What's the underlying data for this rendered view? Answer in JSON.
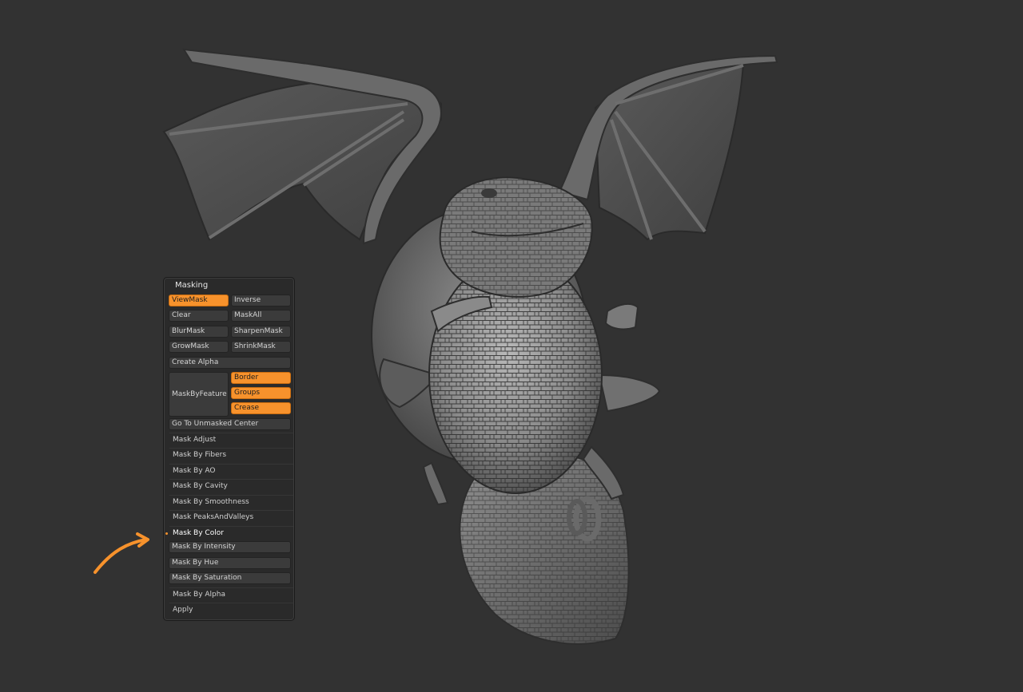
{
  "masking_panel": {
    "title": "Masking",
    "view_mask": "ViewMask",
    "inverse": "Inverse",
    "clear": "Clear",
    "mask_all": "MaskAll",
    "blur_mask": "BlurMask",
    "sharpen_mask": "SharpenMask",
    "grow_mask": "GrowMask",
    "shrink_mask": "ShrinkMask",
    "create_alpha": "Create Alpha",
    "mask_by_feature": "MaskByFeature",
    "border": "Border",
    "groups": "Groups",
    "crease": "Crease",
    "go_to_unmasked_center": "Go To Unmasked Center",
    "sub_items": [
      "Mask Adjust",
      "Mask By Fibers",
      "Mask By AO",
      "Mask By Cavity",
      "Mask By Smoothness",
      "Mask PeaksAndValleys",
      "Mask By Color",
      "Mask By Intensity",
      "Mask By Hue",
      "Mask By Saturation",
      "Mask By Alpha",
      "Apply"
    ]
  },
  "colors": {
    "background": "#323232",
    "panel": "#2a2a2a",
    "accent": "#f7922c",
    "button": "#3b3b3b"
  }
}
